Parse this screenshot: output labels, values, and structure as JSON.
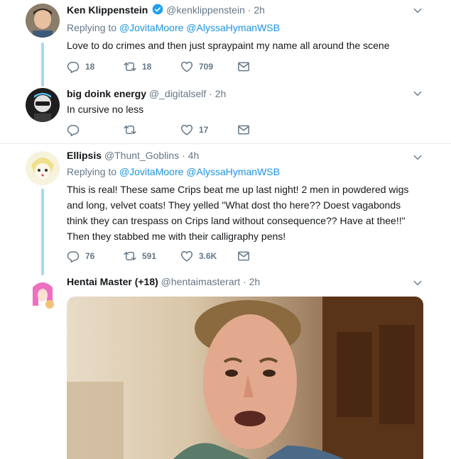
{
  "tweets": [
    {
      "name": "Ken Klippenstein",
      "verified": true,
      "handle": "@kenklippenstein",
      "dot": "·",
      "time": "2h",
      "replying_prefix": "Replying to",
      "replying_to": [
        "@JovitaMoore",
        "@AlyssaHymanWSB"
      ],
      "text": "Love to do crimes and then just spraypaint my name all around the scene",
      "replies": "18",
      "retweets": "18",
      "likes": "709"
    },
    {
      "name": "big doink energy",
      "handle": "@_digitalself",
      "dot": "·",
      "time": "2h",
      "text": "In cursive no less",
      "replies": "",
      "retweets": "",
      "likes": "17"
    },
    {
      "name": "Ellipsis",
      "handle": "@Thunt_Goblins",
      "dot": "·",
      "time": "4h",
      "replying_prefix": "Replying to",
      "replying_to": [
        "@JovitaMoore",
        "@AlyssaHymanWSB"
      ],
      "text": "This is real! These same Crips beat me up last night! 2 men in powdered wigs and long, velvet coats! They yelled \"What dost tho here?? Doest vagabonds think they can trespass on Crips land without consequence?? Have at thee!!\" Then they stabbed me with their calligraphy pens!",
      "replies": "76",
      "retweets": "591",
      "likes": "3.6K"
    },
    {
      "name": "Hentai Master (+18)",
      "handle": "@hentaimasterart",
      "dot": "·",
      "time": "2h"
    }
  ],
  "colors": {
    "accent": "#1b95e0",
    "thread": "#a7d8f0",
    "muted": "#657786",
    "verified": "#1da1f2"
  },
  "icons": [
    "reply-icon",
    "retweet-icon",
    "like-icon",
    "message-icon",
    "chevron-down-icon",
    "verified-badge-icon"
  ]
}
